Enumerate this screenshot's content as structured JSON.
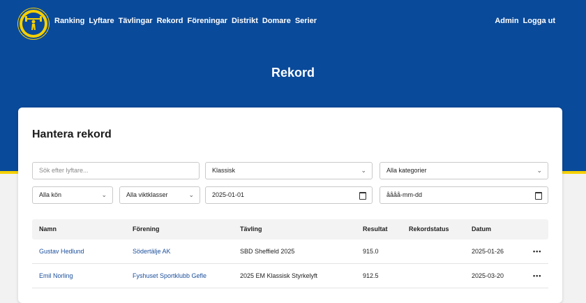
{
  "nav": {
    "logo_icon": "weightlifter-emblem-icon",
    "links": [
      "Ranking",
      "Lyftare",
      "Tävlingar",
      "Rekord",
      "Föreningar",
      "Distrikt",
      "Domare",
      "Serier"
    ],
    "right": [
      "Admin",
      "Logga ut"
    ]
  },
  "hero": {
    "title": "Rekord"
  },
  "card": {
    "title": "Hantera rekord",
    "filters": {
      "search_placeholder": "Sök efter lyftare...",
      "type": "Klassisk",
      "category": "Alla kategorier",
      "gender": "Alla kön",
      "weight_class": "Alla viktklasser",
      "date_from": "2025-01-01",
      "date_to": "åååå-mm-dd"
    },
    "table": {
      "headers": [
        "Namn",
        "Förening",
        "Tävling",
        "Resultat",
        "Rekordstatus",
        "Datum"
      ],
      "rows": [
        {
          "name": "Gustav Hedlund",
          "club": "Södertälje AK",
          "competition": "SBD Sheffield 2025",
          "result": "915.0",
          "status": "",
          "date": "2025-01-26",
          "more": "•••"
        },
        {
          "name": "Emil Norling",
          "club": "Fyshuset Sportklubb Gefle",
          "competition": "2025 EM Klassisk Styrkelyft",
          "result": "912.5",
          "status": "",
          "date": "2025-03-20",
          "more": "•••"
        }
      ]
    }
  },
  "colors": {
    "brand_blue": "#0a4a9a",
    "accent_yellow": "#f5d000",
    "link": "#1b4f9c"
  }
}
